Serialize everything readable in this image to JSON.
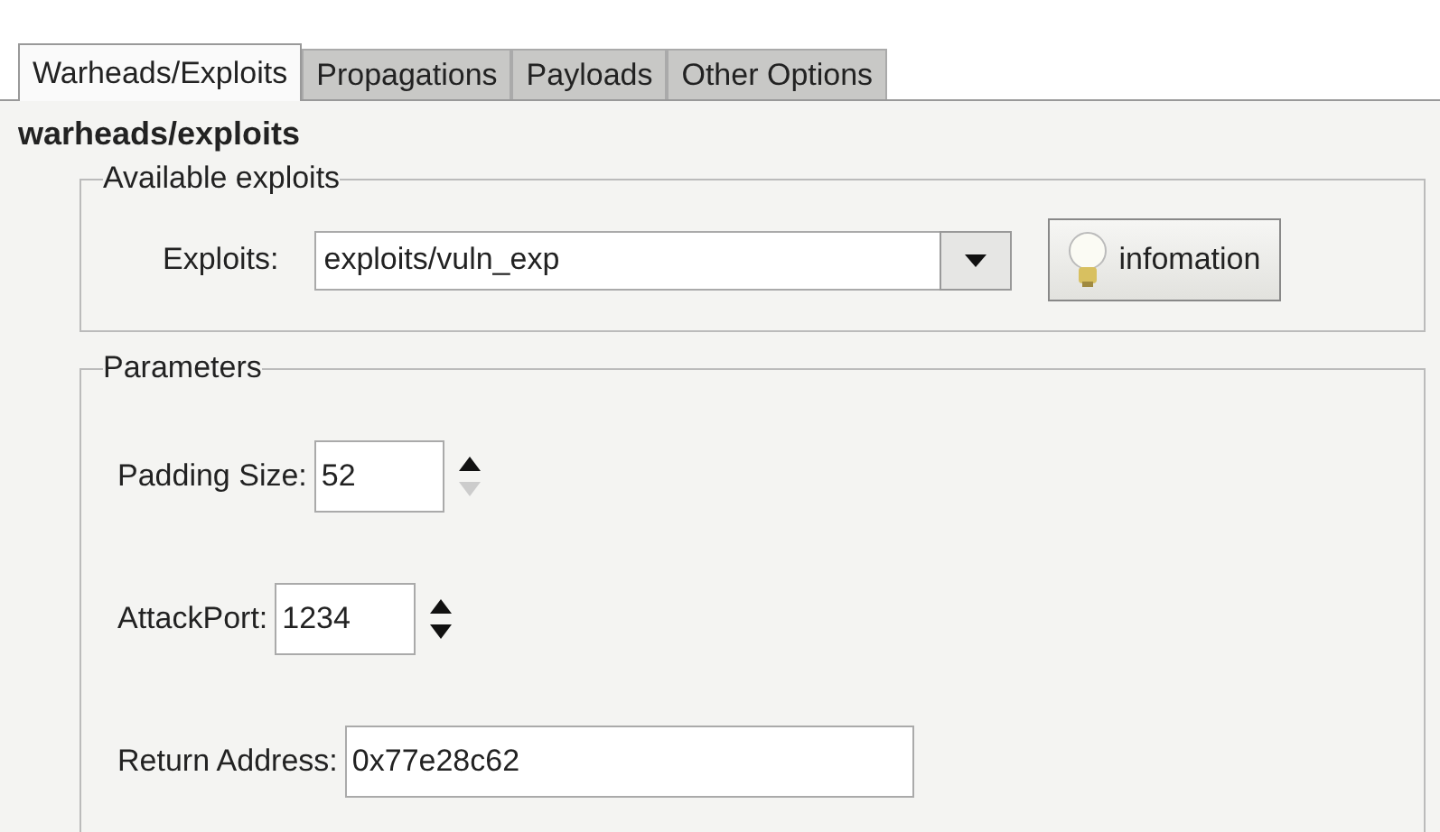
{
  "tabs": [
    {
      "label": "Warheads/Exploits",
      "selected": true
    },
    {
      "label": "Propagations",
      "selected": false
    },
    {
      "label": "Payloads",
      "selected": false
    },
    {
      "label": "Other Options",
      "selected": false
    }
  ],
  "heading": "warheads/exploits",
  "exploits_group": {
    "title": "Available exploits",
    "label": "Exploits:",
    "value": "exploits/vuln_exp",
    "button": "infomation"
  },
  "parameters_group": {
    "title": "Parameters",
    "rows": [
      {
        "kind": "spinner",
        "label": "Padding Size:",
        "value": "52",
        "up_disabled": false,
        "down_disabled": true
      },
      {
        "kind": "spinner",
        "label": "AttackPort:",
        "value": "1234",
        "up_disabled": false,
        "down_disabled": false
      },
      {
        "kind": "text",
        "label": "Return Address:",
        "value": "0x77e28c62"
      }
    ]
  }
}
